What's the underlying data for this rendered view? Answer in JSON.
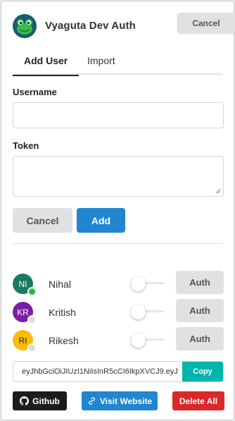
{
  "app": {
    "title": "Vyaguta Dev Auth",
    "cancel_label": "Cancel",
    "logo_icon": "frog-logo-icon"
  },
  "tabs": [
    {
      "label": "Add User",
      "active": true
    },
    {
      "label": "Import",
      "active": false
    }
  ],
  "form": {
    "username_label": "Username",
    "username_value": "",
    "token_label": "Token",
    "token_value": "",
    "cancel_label": "Cancel",
    "add_label": "Add"
  },
  "users": [
    {
      "initials": "NI",
      "name": "Nihal",
      "avatar_bg": "#1a7a5e",
      "avatar_fg": "#ffffff",
      "status": "online",
      "status_color": "#21ba45",
      "toggle_on": false,
      "auth_label": "Auth"
    },
    {
      "initials": "KR",
      "name": "Kritish",
      "avatar_bg": "#7b1fa2",
      "avatar_fg": "#ffffff",
      "status": "offline",
      "status_color": "#dcdcdc",
      "toggle_on": false,
      "auth_label": "Auth"
    },
    {
      "initials": "RI",
      "name": "Rikesh",
      "avatar_bg": "#fbbd08",
      "avatar_fg": "#222222",
      "status": "offline",
      "status_color": "#dcdcdc",
      "toggle_on": false,
      "auth_label": "Auth"
    }
  ],
  "token_bar": {
    "value": "eyJhbGciOiJIUzI1NiIsInR5cCI6IkpXVCJ9.eyJ",
    "copy_label": "Copy"
  },
  "footer": {
    "github_label": "Github",
    "github_icon": "github-icon",
    "visit_label": "Visit Website",
    "visit_icon": "link-icon",
    "delete_label": "Delete All"
  },
  "colors": {
    "primary": "#2185d0",
    "teal": "#00b5ad",
    "danger": "#db2828",
    "dark": "#1b1c1d",
    "grey_button": "#e0e1e2"
  }
}
